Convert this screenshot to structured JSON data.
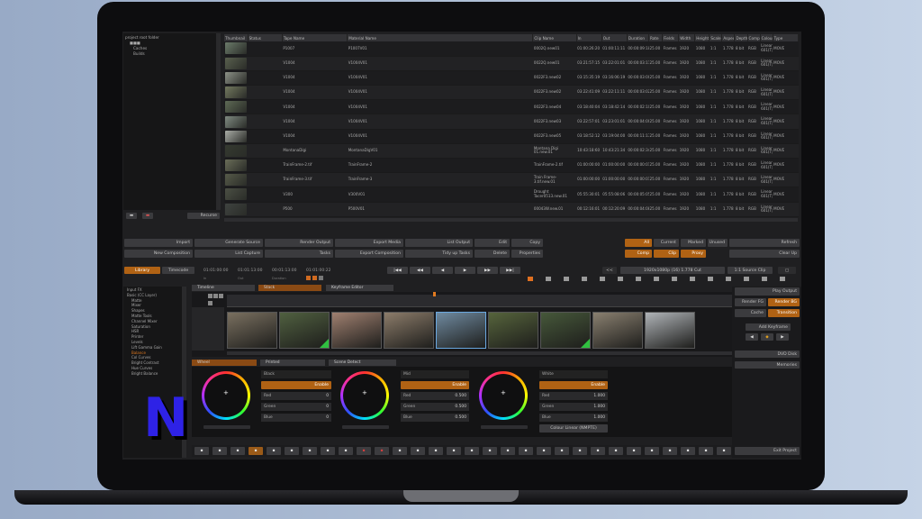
{
  "tree": {
    "items": [
      "project root folder",
      "■■■",
      "Caches",
      "Builds"
    ]
  },
  "clips": {
    "columns": [
      "Thumbnail",
      "Status",
      "Tape Name",
      "Material Name",
      "Clip Name",
      "In",
      "Out",
      "Duration",
      "Rate",
      "Fields",
      "Width",
      "Height",
      "Scale",
      "Aspect",
      "Depth",
      "Comp",
      "Colour",
      "Type"
    ],
    "rows": [
      {
        "tape": "P1007",
        "material": "P1007V01",
        "clip": "0002Q.new01",
        "in": "01:00:26:20",
        "out": "01:00:11:11",
        "dur": "00:00:09:18",
        "rate": "25.00",
        "fields": "Frames",
        "w": "1920",
        "h": "1080",
        "scale": "1:1",
        "aspect": "1.778",
        "depth": "8 bit",
        "comp": "RGB",
        "colour": "Linear 601(T)",
        "type": "MOVE",
        "thumb": "#6b7b6a"
      },
      {
        "tape": "V1004",
        "material": "V1004V01",
        "clip": "0022Q.new01",
        "in": "03:21:57:15",
        "out": "03:22:01:01",
        "dur": "00:00:03:11",
        "rate": "25.00",
        "fields": "Frames",
        "w": "1920",
        "h": "1080",
        "scale": "1:1",
        "aspect": "1.778",
        "depth": "8 bit",
        "comp": "RGB",
        "colour": "Linear 601(T)",
        "type": "MOVE",
        "thumb": "#59604e"
      },
      {
        "tape": "V1004",
        "material": "V1004V01",
        "clip": "0022F3.new02",
        "in": "03:15:35:19",
        "out": "03:16:06:19",
        "dur": "00:00:03:00",
        "rate": "25.00",
        "fields": "Frames",
        "w": "1920",
        "h": "1080",
        "scale": "1:1",
        "aspect": "1.778",
        "depth": "8 bit",
        "comp": "RGB",
        "colour": "Linear 601(T)",
        "type": "MOVE",
        "thumb": "#8d9288"
      },
      {
        "tape": "V1004",
        "material": "V1004V01",
        "clip": "0022F3.new02",
        "in": "03:22:41:09",
        "out": "03:22:11:11",
        "dur": "00:00:03:02",
        "rate": "25.00",
        "fields": "Frames",
        "w": "1920",
        "h": "1080",
        "scale": "1:1",
        "aspect": "1.778",
        "depth": "8 bit",
        "comp": "RGB",
        "colour": "Linear 601(T)",
        "type": "MOVE",
        "thumb": "#73795f"
      },
      {
        "tape": "V1004",
        "material": "V1004V01",
        "clip": "0022F3.new04",
        "in": "03:18:40:04",
        "out": "03:18:42:14",
        "dur": "00:00:02:10",
        "rate": "25.00",
        "fields": "Frames",
        "w": "1920",
        "h": "1080",
        "scale": "1:1",
        "aspect": "1.778",
        "depth": "8 bit",
        "comp": "RGB",
        "colour": "Linear 601(T)",
        "type": "MOVE",
        "thumb": "#5e6a55"
      },
      {
        "tape": "V1004",
        "material": "V1004V01",
        "clip": "0022F3.new03",
        "in": "03:22:57:01",
        "out": "03:23:01:01",
        "dur": "00:00:04:00",
        "rate": "25.00",
        "fields": "Frames",
        "w": "1920",
        "h": "1080",
        "scale": "1:1",
        "aspect": "1.778",
        "depth": "8 bit",
        "comp": "RGB",
        "colour": "Linear 601(T)",
        "type": "MOVE",
        "thumb": "#7f8a81"
      },
      {
        "tape": "V1004",
        "material": "V1004V01",
        "clip": "0022F3.new05",
        "in": "03:18:52:12",
        "out": "03:19:04:00",
        "dur": "00:00:11:13",
        "rate": "25.00",
        "fields": "Frames",
        "w": "1920",
        "h": "1080",
        "scale": "1:1",
        "aspect": "1.778",
        "depth": "8 bit",
        "comp": "RGB",
        "colour": "Linear 601(T)",
        "type": "MOVE",
        "thumb": "#a9aca6"
      },
      {
        "tape": "MontanaDigi",
        "material": "MontanaDigV01",
        "clip": "Montana Digi 01.new.01",
        "in": "10:43:18:60",
        "out": "10:43:21:34",
        "dur": "00:00:02:34",
        "rate": "25.00",
        "fields": "Frames",
        "w": "1920",
        "h": "1080",
        "scale": "1:1",
        "aspect": "1.778",
        "depth": "8 bit",
        "comp": "RGB",
        "colour": "Linear 601(T)",
        "type": "MOVE",
        "thumb": "#353a30"
      },
      {
        "tape": "TrainFrame-2.tif",
        "material": "TrainFrame-2",
        "clip": "TrainFrame-2.tif",
        "in": "01:00:00:00",
        "out": "01:00:00:00",
        "dur": "00:00:00:01",
        "rate": "25.00",
        "fields": "Frames",
        "w": "1920",
        "h": "1080",
        "scale": "1:1",
        "aspect": "1.778",
        "depth": "8 bit",
        "comp": "RGB",
        "colour": "Linear 601(T)",
        "type": "MOVE",
        "thumb": "#6a6d58"
      },
      {
        "tape": "TrainFrame-3.tif",
        "material": "TrainFrame-3",
        "clip": "Train Frame-3.tif.new.01",
        "in": "01:00:00:00",
        "out": "01:00:00:00",
        "dur": "00:00:00:01",
        "rate": "25.00",
        "fields": "Frames",
        "w": "1920",
        "h": "1080",
        "scale": "1:1",
        "aspect": "1.778",
        "depth": "8 bit",
        "comp": "RGB",
        "colour": "Linear 601(T)",
        "type": "MOVE",
        "thumb": "#565a49"
      },
      {
        "tape": "V300",
        "material": "V300V01",
        "clip": "Drought Tacer0513.new.01",
        "in": "05:55:30:01",
        "out": "05:55:08:06",
        "dur": "00:00:05:05",
        "rate": "25.00",
        "fields": "Frames",
        "w": "1920",
        "h": "1080",
        "scale": "1:1",
        "aspect": "1.778",
        "depth": "8 bit",
        "comp": "RGB",
        "colour": "Linear 601(T)",
        "type": "MOVE",
        "thumb": "#4b4f44"
      },
      {
        "tape": "P500",
        "material": "P500V01",
        "clip": "00043W.new.01",
        "in": "00:12:16:01",
        "out": "00:12:20:09",
        "dur": "00:00:04:08",
        "rate": "25.00",
        "fields": "Frames",
        "w": "1920",
        "h": "1080",
        "scale": "1:1",
        "aspect": "1.778",
        "depth": "8 bit",
        "comp": "RGB",
        "colour": "Linear 601(T)",
        "type": "MOVE",
        "thumb": "#3f4340"
      }
    ]
  },
  "tree_buttons": {
    "recurse": "Recurse"
  },
  "actions": {
    "row1": [
      "Import",
      "Generate Source",
      "Render Output",
      "Export Media",
      "List Output",
      "Edit",
      "Copy"
    ],
    "row2": [
      "New Composition",
      "List Capture",
      "Tasks",
      "Export Composition",
      "Tidy up Tasks",
      "Delete",
      "Properties"
    ],
    "filters1": [
      "All",
      "Current",
      "Marked",
      "Unused"
    ],
    "filters2": [
      "Comp",
      "Clip",
      "Proxy"
    ],
    "refresh": "Refresh",
    "clear_up": "Clear Up"
  },
  "transport": {
    "library": "Library",
    "timecode": "Timecode",
    "tc_in": "01:01:00:00",
    "tc_out": "01:01:13:00",
    "tc_dur": "00:01:13:00",
    "tc_cur": "01:01:00:22",
    "lbl_in": "In",
    "lbl_out": "Out",
    "lbl_dur": "Duration",
    "format": "1920x1080p (16) 1.778 Cut",
    "source": "1:1 Source Clip"
  },
  "effects": {
    "items": [
      "Input FX",
      "Basic (CC Layer)",
      "Matte",
      "Mixer",
      "Shapes",
      "Matte Tools",
      "Channel Mixer",
      "Saturation",
      "HSR",
      "Printer",
      "Levels",
      "Lift Gamma Gain",
      "Balance",
      "Col Curves",
      "Bright Contrast",
      "Hue Curves",
      "Bright Balance",
      "",
      ""
    ]
  },
  "tabs_top": {
    "timeline": "Timeline",
    "stack": "Stack",
    "keyframe": "Keyframe Editor"
  },
  "tabs_bottom": {
    "wheel": "Wheel",
    "printed": "Printed",
    "scene": "Scene Detect"
  },
  "grade": {
    "black": {
      "title": "Black",
      "enable": "Enable",
      "red": "0",
      "green": "0",
      "blue": "0"
    },
    "mid": {
      "title": "Mid",
      "enable": "Enable",
      "red": "0.500",
      "green": "0.500",
      "blue": "0.500"
    },
    "white": {
      "title": "White",
      "enable": "Enable",
      "red": "1.000",
      "green": "1.000",
      "blue": "1.000"
    },
    "red_label": "Red",
    "green_label": "Green",
    "blue_label": "Blue",
    "colour_mode": "Colour Linear (NMPTE)"
  },
  "right_panel": {
    "play_output": "Play Output",
    "render_fg": "Render FG",
    "render_bg": "Render BG",
    "cache": "Cache",
    "transition": "Transition",
    "add_keyframe": "Add Keyframe",
    "dvd_disk": "DVD Disk",
    "memories": "Memories",
    "exit_project": "Exit Project"
  },
  "overlay": {
    "letter": "N"
  }
}
